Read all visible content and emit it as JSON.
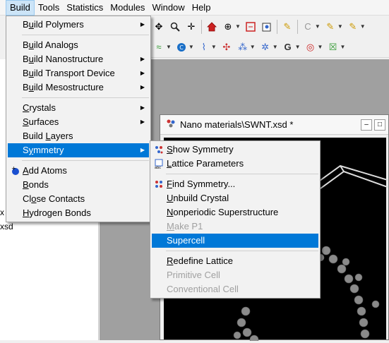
{
  "menubar": {
    "items": [
      {
        "label": "Build",
        "active": true
      },
      {
        "label": "Tools"
      },
      {
        "label": "Statistics"
      },
      {
        "label": "Modules"
      },
      {
        "label": "Window"
      },
      {
        "label": "Help"
      }
    ]
  },
  "toolbar1": {
    "icons": [
      "move-icon",
      "zoom-icon",
      "translate-icon",
      "home-icon",
      "center-icon",
      "fit-icon",
      "display-style-icon",
      "sketch-pencil-icon",
      "bond-icon",
      "atom-icon",
      "pen-icon"
    ],
    "element_text": "C"
  },
  "toolbar2": {
    "icons": [
      "wave-icon",
      "color-icon",
      "lattice-icon",
      "molecule-icon",
      "symmetry-icon",
      "gradient-icon",
      "target-icon",
      "cluster-icon"
    ]
  },
  "left_panel": {
    "tree_lines": [
      "x",
      "xsd"
    ]
  },
  "document": {
    "title": "Nano materials\\SWNT.xsd *",
    "controls": [
      "minimize",
      "maximize"
    ]
  },
  "build_menu": {
    "groups": [
      [
        {
          "label": "Build Polymers",
          "mnemonic": "u",
          "submenu": true
        }
      ],
      [
        {
          "label": "Build Analogs",
          "mnemonic": "u",
          "submenu": false
        },
        {
          "label": "Build Nanostructure",
          "mnemonic": "u",
          "submenu": true
        },
        {
          "label": "Build Transport Device",
          "mnemonic": "u",
          "submenu": true
        },
        {
          "label": "Build Mesostructure",
          "mnemonic": "u",
          "submenu": true
        }
      ],
      [
        {
          "label": "Crystals",
          "mnemonic": "C",
          "submenu": true
        },
        {
          "label": "Surfaces",
          "mnemonic": "S",
          "submenu": true
        },
        {
          "label": "Build Layers",
          "mnemonic": "L",
          "submenu": false
        },
        {
          "label": "Symmetry",
          "mnemonic": "y",
          "submenu": true,
          "highlighted": true
        }
      ],
      [
        {
          "label": "Add Atoms",
          "mnemonic": "A",
          "submenu": false,
          "icon": "add-atoms-icon"
        },
        {
          "label": "Bonds",
          "mnemonic": "B",
          "submenu": false
        },
        {
          "label": "Close Contacts",
          "mnemonic": "o",
          "submenu": false
        },
        {
          "label": "Hydrogen Bonds",
          "mnemonic": "H",
          "submenu": false
        }
      ]
    ]
  },
  "symmetry_menu": {
    "groups": [
      [
        {
          "label": "Show Symmetry",
          "mnemonic": "S",
          "icon": "show-symmetry-icon"
        },
        {
          "label": "Lattice Parameters",
          "mnemonic": "L",
          "icon": "lattice-parameters-icon"
        }
      ],
      [
        {
          "label": "Find Symmetry...",
          "mnemonic": "F",
          "icon": "find-symmetry-icon"
        },
        {
          "label": "Unbuild Crystal",
          "mnemonic": "U"
        },
        {
          "label": "Nonperiodic Superstructure",
          "mnemonic": "N"
        },
        {
          "label": "Make P1",
          "mnemonic": "M",
          "disabled": true
        },
        {
          "label": "Supercell",
          "mnemonic": "",
          "highlighted": true
        }
      ],
      [
        {
          "label": "Redefine Lattice",
          "mnemonic": "R"
        },
        {
          "label": "Primitive Cell",
          "mnemonic": "",
          "disabled": true
        },
        {
          "label": "Conventional Cell",
          "mnemonic": "",
          "disabled": true
        }
      ]
    ]
  },
  "colors": {
    "highlight": "#0078d7",
    "menu_bg": "#f2f2f2",
    "disabled_text": "#a0a0a0",
    "workspace": "#a0a0a0",
    "viewport": "#000000",
    "atom": "#8a8a8a"
  }
}
